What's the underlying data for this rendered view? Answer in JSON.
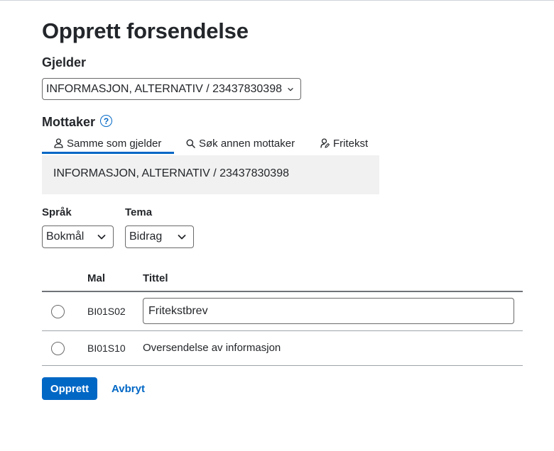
{
  "page_title": "Opprett forsendelse",
  "gjelder": {
    "label": "Gjelder",
    "selected": "INFORMASJON, ALTERNATIV / 23437830398"
  },
  "mottaker": {
    "label": "Mottaker",
    "help_icon": "?",
    "tabs": [
      {
        "label": "Samme som gjelder",
        "icon": "person-icon",
        "selected": true
      },
      {
        "label": "Søk annen mottaker",
        "icon": "search-icon",
        "selected": false
      },
      {
        "label": "Fritekst",
        "icon": "person-edit-icon",
        "selected": false
      }
    ],
    "panel_text": "INFORMASJON, ALTERNATIV / 23437830398"
  },
  "sprak": {
    "label": "Språk",
    "selected": "Bokmål"
  },
  "tema": {
    "label": "Tema",
    "selected": "Bidrag"
  },
  "table": {
    "headers": {
      "mal": "Mal",
      "tittel": "Tittel"
    },
    "rows": [
      {
        "mal": "BI01S02",
        "tittel": "Fritekstbrev",
        "editable": true,
        "selected": false
      },
      {
        "mal": "BI01S10",
        "tittel": "Oversendelse av informasjon",
        "editable": false,
        "selected": false
      }
    ]
  },
  "actions": {
    "submit_label": "Opprett",
    "cancel_label": "Avbryt"
  },
  "colors": {
    "accent": "#0067c5",
    "panel_bg": "#f1f1f1",
    "text": "#23262a",
    "border": "#6a6a6a"
  }
}
